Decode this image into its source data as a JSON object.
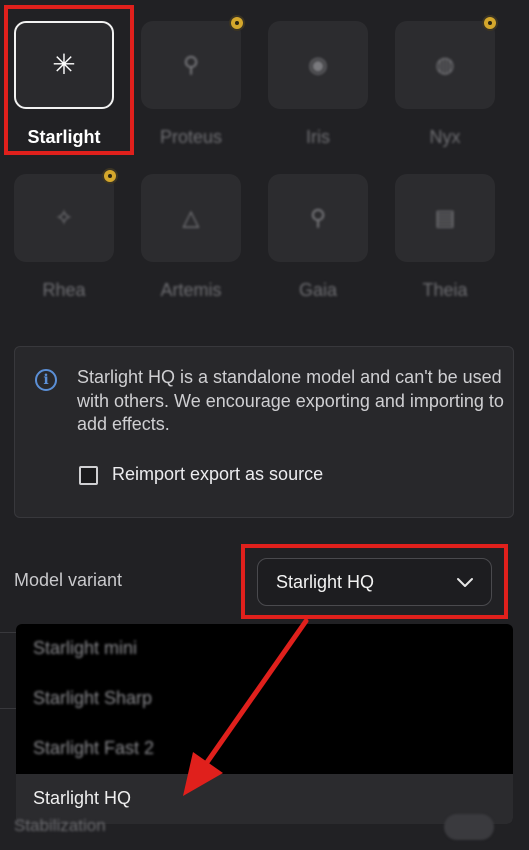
{
  "models": [
    {
      "name": "Starlight",
      "icon": "✳",
      "icon_name": "asterisk-icon",
      "selected": true,
      "badge": false
    },
    {
      "name": "Proteus",
      "icon": "⚲",
      "icon_name": "magic-wand-icon",
      "selected": false,
      "badge": true
    },
    {
      "name": "Iris",
      "icon": "◉",
      "icon_name": "face-icon",
      "selected": false,
      "badge": false
    },
    {
      "name": "Nyx",
      "icon": "◍",
      "icon_name": "moon-icon",
      "selected": false,
      "badge": true
    },
    {
      "name": "Rhea",
      "icon": "✧",
      "icon_name": "sparkle-icon",
      "selected": false,
      "badge": true
    },
    {
      "name": "Artemis",
      "icon": "△",
      "icon_name": "triangle-icon",
      "selected": false,
      "badge": false
    },
    {
      "name": "Gaia",
      "icon": "⚲",
      "icon_name": "brush-icon",
      "selected": false,
      "badge": false
    },
    {
      "name": "Theia",
      "icon": "▤",
      "icon_name": "grid-icon",
      "selected": false,
      "badge": false
    }
  ],
  "info": {
    "icon": "i",
    "text": "Starlight HQ is a standalone model and can't be used with others. We encourage exporting and importing to add effects.",
    "checkbox_label": "Reimport export as source",
    "checkbox_checked": false
  },
  "variant": {
    "label": "Model variant",
    "value": "Starlight HQ",
    "chevron": "⌄"
  },
  "dropdown": {
    "options": [
      "Starlight mini",
      "Starlight Sharp",
      "Starlight Fast 2",
      "Starlight HQ"
    ],
    "selected": "Starlight HQ"
  },
  "footer": {
    "stabilization_label": "Stabilization"
  },
  "colors": {
    "annotation_red": "#e0201c",
    "badge_gold": "#d4a72c",
    "info_blue": "#5b8fd6"
  }
}
